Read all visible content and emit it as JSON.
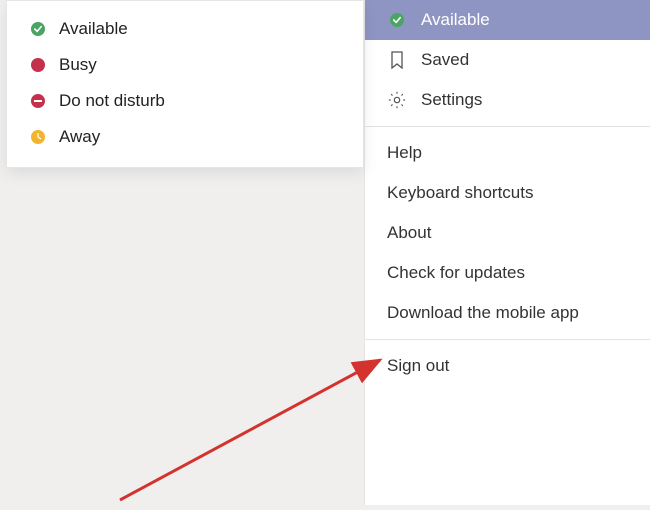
{
  "status_menu": {
    "items": [
      {
        "label": "Available",
        "color": "#4aa564",
        "type": "available"
      },
      {
        "label": "Busy",
        "color": "#c4314b",
        "type": "busy"
      },
      {
        "label": "Do not disturb",
        "color": "#c4314b",
        "type": "dnd"
      },
      {
        "label": "Away",
        "color": "#f2b42f",
        "type": "away"
      }
    ]
  },
  "main_menu": {
    "status": {
      "label": "Available",
      "color": "#4aa564"
    },
    "saved": "Saved",
    "settings": "Settings",
    "help": "Help",
    "keyboard": "Keyboard shortcuts",
    "about": "About",
    "updates": "Check for updates",
    "download": "Download the mobile app",
    "signout": "Sign out"
  }
}
